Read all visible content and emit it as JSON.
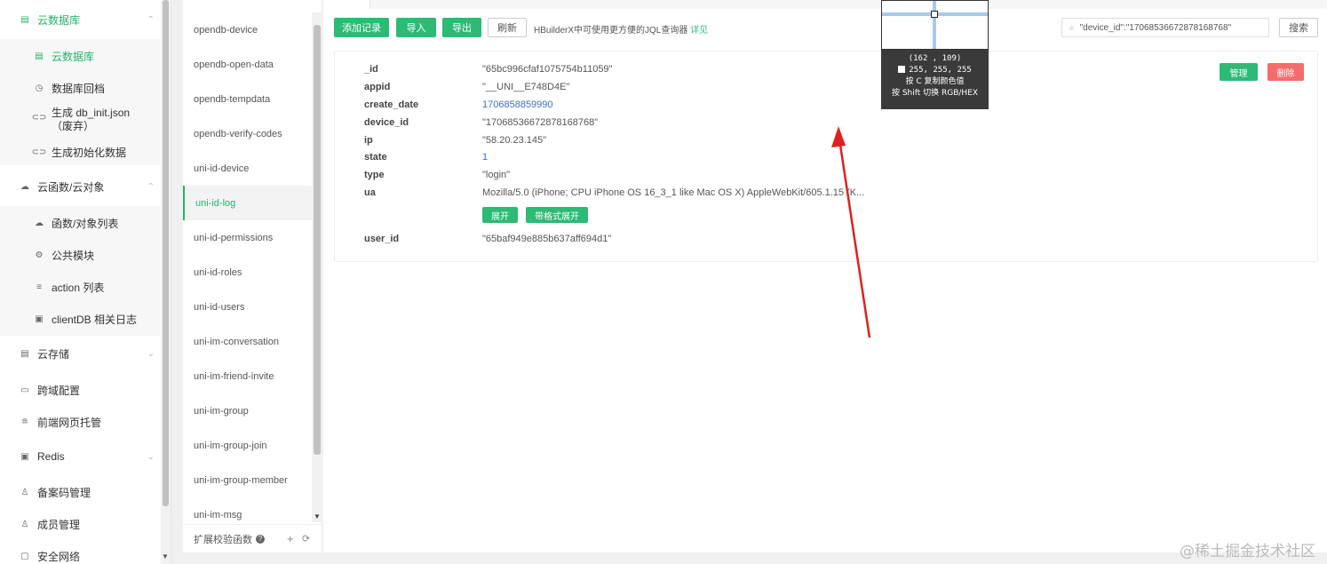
{
  "sidebar": {
    "items": [
      {
        "label": "云数据库",
        "icon": "database-icon",
        "level": 1,
        "active": true,
        "chevron": "^"
      },
      {
        "label": "云数据库",
        "icon": "table-icon",
        "level": 2,
        "active": true
      },
      {
        "label": "数据库回档",
        "icon": "history-icon",
        "level": 2
      },
      {
        "label": "生成 db_init.json（废弃）",
        "icon": "link-icon",
        "level": 2
      },
      {
        "label": "生成初始化数据",
        "icon": "link-icon",
        "level": 2
      },
      {
        "label": "云函数/云对象",
        "icon": "cloud-icon",
        "level": 1,
        "chevron": "^"
      },
      {
        "label": "函数/对象列表",
        "icon": "cloud-icon",
        "level": 2
      },
      {
        "label": "公共模块",
        "icon": "module-icon",
        "level": 2
      },
      {
        "label": "action 列表",
        "icon": "list-icon",
        "level": 2
      },
      {
        "label": "clientDB 相关日志",
        "icon": "log-icon",
        "level": 2
      },
      {
        "label": "云存储",
        "icon": "storage-icon",
        "level": 1,
        "chevron": "v"
      },
      {
        "label": "跨域配置",
        "icon": "cors-icon",
        "level": 1
      },
      {
        "label": "前端网页托管",
        "icon": "hosting-icon",
        "level": 1
      },
      {
        "label": "Redis",
        "icon": "redis-icon",
        "level": 1,
        "chevron": "v"
      },
      {
        "label": "备案码管理",
        "icon": "user-icon",
        "level": 1
      },
      {
        "label": "成员管理",
        "icon": "user-icon",
        "level": 1
      },
      {
        "label": "安全网络",
        "icon": "shield-icon",
        "level": 1
      }
    ]
  },
  "collections": {
    "items": [
      "opendb-device",
      "opendb-open-data",
      "opendb-tempdata",
      "opendb-verify-codes",
      "uni-id-device",
      "uni-id-log",
      "uni-id-permissions",
      "uni-id-roles",
      "uni-id-users",
      "uni-im-conversation",
      "uni-im-friend-invite",
      "uni-im-group",
      "uni-im-group-join",
      "uni-im-group-member",
      "uni-im-msg"
    ],
    "active": "uni-id-log",
    "footer_label": "扩展校验函数",
    "add_symbol": "+",
    "refresh_symbol": "⟳"
  },
  "toolbar": {
    "add_label": "添加记录",
    "import_label": "导入",
    "export_label": "导出",
    "refresh_label": "刷新",
    "hint_text": "HBuilderX中可使用更方便的JQL查询器",
    "hint_link": "详见",
    "search_value": "\"device_id\":\"17068536672878168768\"",
    "search_button": "搜索"
  },
  "record": {
    "fields": [
      {
        "key": "_id",
        "value": "\"65bc996cfaf1075754b11059\"",
        "numeric": false
      },
      {
        "key": "appid",
        "value": "\"__UNI__E748D4E\"",
        "numeric": false
      },
      {
        "key": "create_date",
        "value": "1706858859990",
        "numeric": true
      },
      {
        "key": "device_id",
        "value": "\"17068536672878168768\"",
        "numeric": false
      },
      {
        "key": "ip",
        "value": "\"58.20.23.145\"",
        "numeric": false
      },
      {
        "key": "state",
        "value": "1",
        "numeric": true
      },
      {
        "key": "type",
        "value": "\"login\"",
        "numeric": false
      },
      {
        "key": "ua",
        "value": "Mozilla/5.0 (iPhone; CPU iPhone OS 16_3_1 like Mac OS X) AppleWebKit/605.1.15 (K...",
        "numeric": false
      },
      {
        "key": "user_id",
        "value": "\"65baf949e885b637aff694d1\"",
        "numeric": false
      }
    ],
    "expand_label": "展开",
    "format_expand_label": "带格式展开",
    "manage_label": "管理",
    "delete_label": "删除"
  },
  "magnifier": {
    "coords": "(162 , 109)",
    "rgb": "255, 255, 255",
    "hint_copy": "按 C 复制颜色值",
    "hint_switch": "按 Shift 切换 RGB/HEX",
    "swatch_color": "#ffffff"
  },
  "annotation": {
    "arrow_color": "#e02020"
  },
  "watermark": "@稀土掘金技术社区",
  "colors": {
    "accent": "#2dba75",
    "danger": "#f56c6c",
    "link_number": "#3a6fcf"
  }
}
